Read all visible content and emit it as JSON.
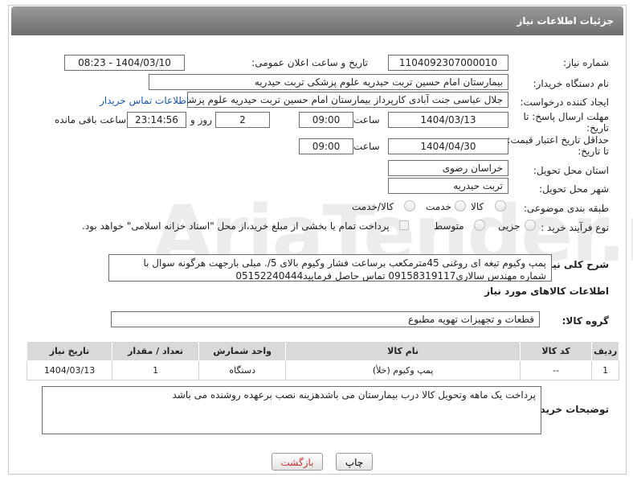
{
  "header": {
    "title": "جزئیات اطلاعات نیاز"
  },
  "fields": {
    "need_number_label": "شماره نیاز:",
    "need_number": "1104092307000010",
    "announce_label": "تاریخ و ساعت اعلان عمومی:",
    "announce_value": "1404/03/10 - 08:23",
    "buyer_org_label": "نام دستگاه خریدار:",
    "buyer_org": "بیمارستان امام حسین تربت حیدریه   علوم پزشکی تربت حیدریه",
    "requester_label": "ایجاد کننده درخواست:",
    "requester": "جلال عباسی جنت آبادی کارپرداز بیمارستان امام حسین تربت حیدریه   علوم پزشکی تربت حیدریه",
    "buyer_contact_link": "اطلاعات تماس خریدار",
    "deadline_label_1": "مهلت ارسال پاسخ: تا",
    "deadline_label_2": "تاریخ:",
    "deadline_date": "1404/03/13",
    "time_label": "ساعت",
    "deadline_time": "09:00",
    "days_value": "2",
    "days_label": "روز و",
    "remaining_time": "23:14:56",
    "remaining_label": "ساعت باقی مانده",
    "price_label_1": "حداقل تاریخ اعتبار قیمت:",
    "price_label_2": "تا تاریخ:",
    "price_date": "1404/04/30",
    "price_time": "09:00",
    "province_label": "استان محل تحویل:",
    "province": "خراسان رضوی",
    "city_label": "شهر محل تحویل:",
    "city": "تربت حیدریه",
    "category_label": "طبقه بندی موضوعی:",
    "category_options": [
      "کالا",
      "خدمت",
      "کالا/خدمت"
    ],
    "process_label": "نوع فرآیند خرید :",
    "process_options": [
      "جزیی",
      "متوسط"
    ],
    "payment_note": "پرداخت تمام یا بخشی از مبلغ خرید،از محل \"اسناد خزانه اسلامی\" خواهد بود."
  },
  "description": {
    "label": "شرح کلی نیاز:",
    "text": "پمپ وکیوم تیغه ای روغنی 45مترمکعب برساعت فشار وکیوم بالای 5/. میلی بارجهت هرگونه سوال با شماره مهندس سالاری09158319117 تماس حاصل فرمایید05152240444"
  },
  "goods": {
    "section_title": "اطلاعات کالاهای مورد نیاز",
    "group_label": "گروه کالا:",
    "group_value": "قطعات و تجهیزات تهویه مطبوع",
    "columns": [
      "ردیف",
      "کد کالا",
      "نام کالا",
      "واحد شمارش",
      "تعداد / مقدار",
      "تاریخ نیاز"
    ],
    "rows": [
      [
        "1",
        "--",
        "پمپ وکیوم (خلأ)",
        "دستگاه",
        "1",
        "1404/03/13"
      ]
    ]
  },
  "buyer_notes": {
    "label": "توضیحات خریدار:",
    "text": "پرداخت یک ماهه وتحویل کالا درب  بیمارستان می باشدهزینه نصب برعهده روشنده می باشد"
  },
  "buttons": {
    "print": "چاپ",
    "back": "بازگشت"
  },
  "watermark": "AriaTender.neT"
}
